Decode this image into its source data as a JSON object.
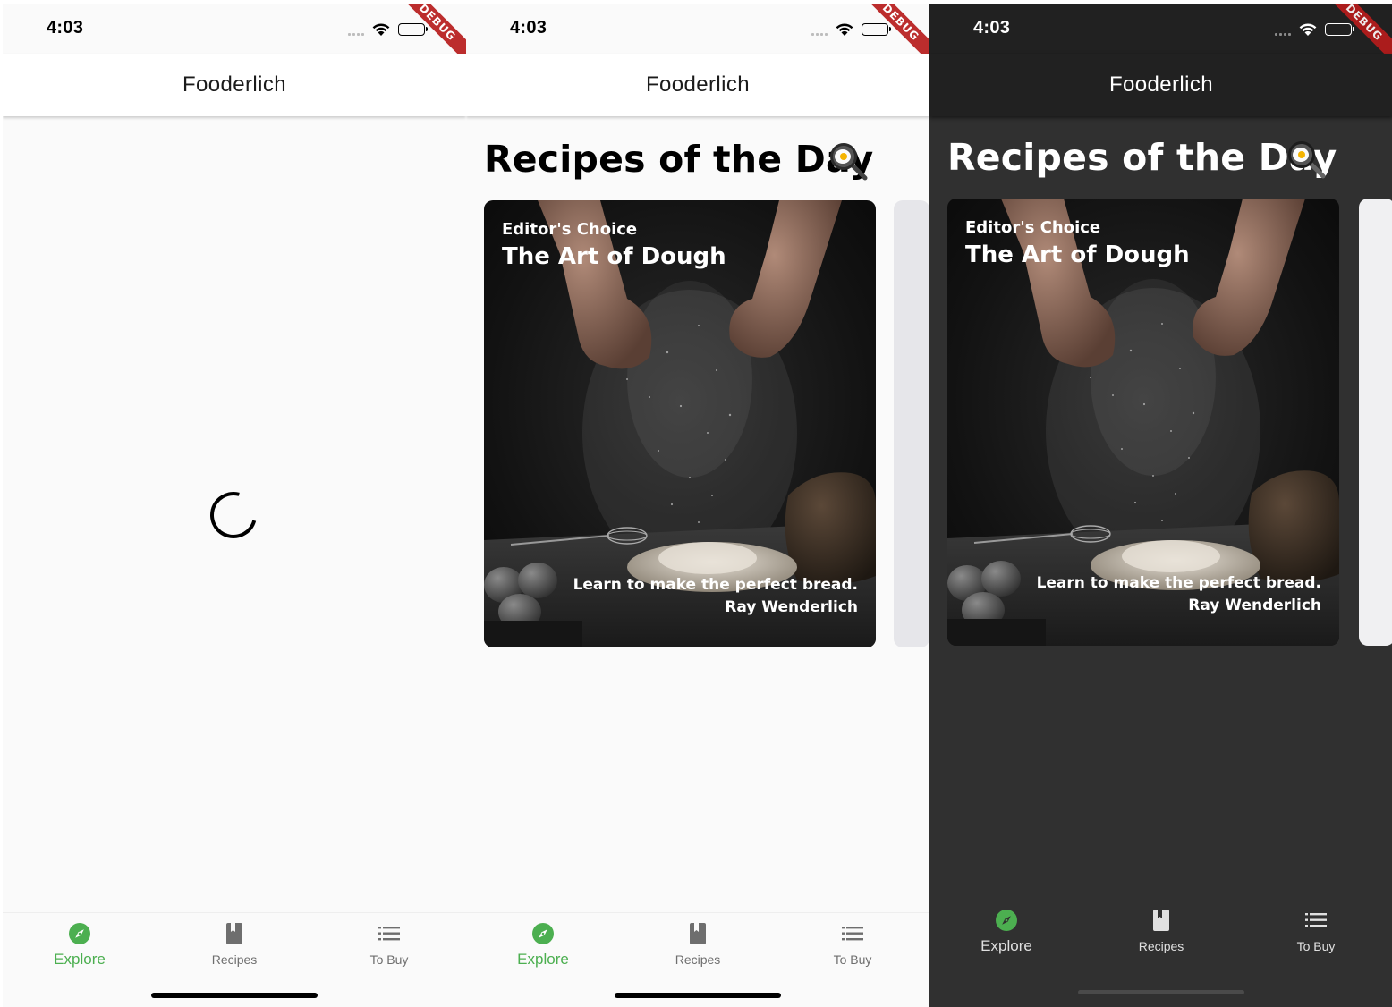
{
  "colors": {
    "accent_green": "#4caf50",
    "debug_red": "#b71c1c",
    "light_background": "#fafafa",
    "dark_background": "#303030",
    "dark_app_bar": "#212121"
  },
  "status_bar": {
    "time": "4:03",
    "icons": [
      "signal-dots-icon",
      "wifi-icon",
      "battery-icon"
    ]
  },
  "debug_banner": "DEBUG",
  "app_bar": {
    "title": "Fooderlich"
  },
  "explore": {
    "section_title": "Recipes of the Day",
    "section_icon": "frying-pan-icon",
    "card": {
      "subtitle": "Editor's Choice",
      "title": "The Art of Dough",
      "description": "Learn to make the perfect bread.",
      "author": "Ray Wenderlich",
      "image": "flour-hands-bread-photo"
    }
  },
  "bottom_nav": {
    "items": [
      {
        "label": "Explore",
        "icon": "compass-icon",
        "selected": true
      },
      {
        "label": "Recipes",
        "icon": "book-icon",
        "selected": false
      },
      {
        "label": "To Buy",
        "icon": "list-icon",
        "selected": false
      }
    ]
  },
  "screens": [
    {
      "theme": "light",
      "state": "loading"
    },
    {
      "theme": "light",
      "state": "loaded"
    },
    {
      "theme": "dark",
      "state": "loaded"
    }
  ]
}
